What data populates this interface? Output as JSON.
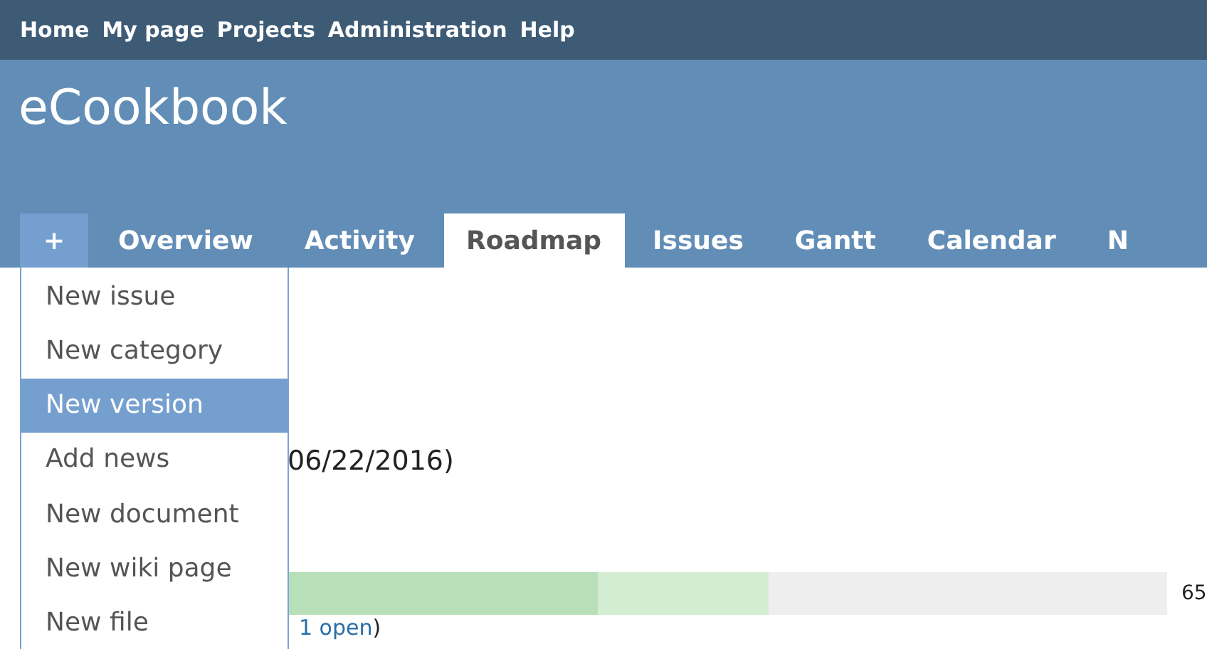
{
  "top_menu": [
    "Home",
    "My page",
    "Projects",
    "Administration",
    "Help"
  ],
  "project_title": "eCookbook",
  "tabs": [
    {
      "label": "+",
      "kind": "new",
      "selected": false
    },
    {
      "label": "Overview",
      "kind": "tab",
      "selected": false
    },
    {
      "label": "Activity",
      "kind": "tab",
      "selected": false
    },
    {
      "label": "Roadmap",
      "kind": "tab",
      "selected": true
    },
    {
      "label": "Issues",
      "kind": "tab",
      "selected": false
    },
    {
      "label": "Gantt",
      "kind": "tab",
      "selected": false
    },
    {
      "label": "Calendar",
      "kind": "tab",
      "selected": false
    },
    {
      "label": "N",
      "kind": "tab",
      "selected": false
    }
  ],
  "new_menu": {
    "items": [
      {
        "label": "New issue",
        "selected": false
      },
      {
        "label": "New category",
        "selected": false
      },
      {
        "label": "New version",
        "selected": true
      },
      {
        "label": "Add news",
        "selected": false
      },
      {
        "label": "New document",
        "selected": false
      },
      {
        "label": "New wiki page",
        "selected": false
      },
      {
        "label": "New file",
        "selected": false
      }
    ]
  },
  "version": {
    "date_text": "06/22/2016)",
    "progress": {
      "closed": {
        "level": 0.5
      },
      "done": {
        "level": 0.65
      }
    },
    "percent": "65",
    "issues_link": "1 open",
    "issues_suffix": ")"
  }
}
